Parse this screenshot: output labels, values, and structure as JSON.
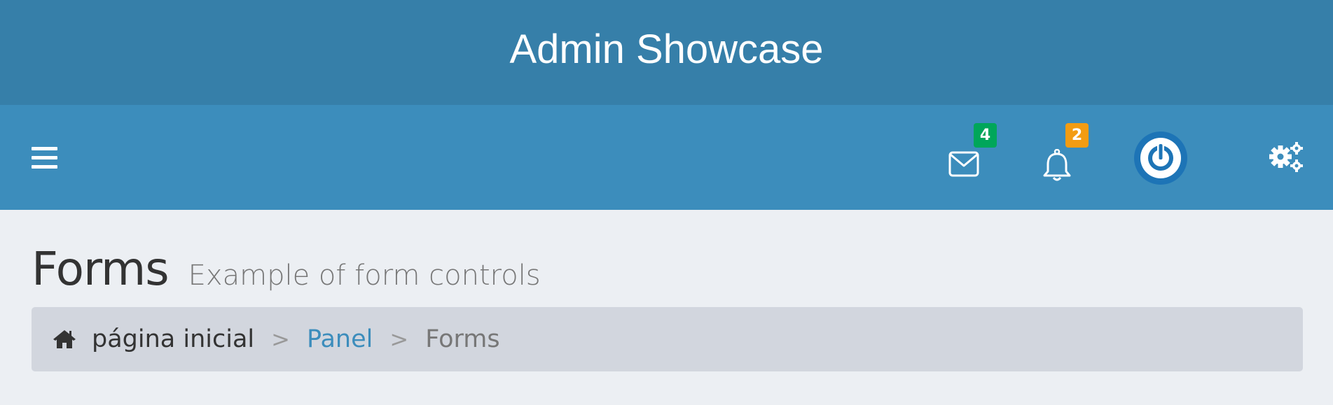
{
  "app": {
    "title": "Admin Showcase"
  },
  "navbar": {
    "menu_icon": "hamburger-menu-icon",
    "messages": {
      "icon": "envelope-icon",
      "count": "4",
      "badge_color": "#00a65a"
    },
    "notifications": {
      "icon": "bell-icon",
      "count": "2",
      "badge_color": "#f39c12"
    },
    "power_icon": "power-icon",
    "settings_icon": "gears-icon"
  },
  "page": {
    "title": "Forms",
    "subtitle": "Example of form controls"
  },
  "breadcrumb": {
    "home_icon": "home-icon",
    "separator": ">",
    "items": [
      {
        "label": "página inicial"
      },
      {
        "label": "Panel"
      },
      {
        "label": "Forms"
      }
    ]
  },
  "colors": {
    "banner": "#367fa9",
    "navbar": "#3c8dbc",
    "background": "#eceff3",
    "breadcrumb_bg": "#d2d6de",
    "link": "#3c8dbc"
  }
}
